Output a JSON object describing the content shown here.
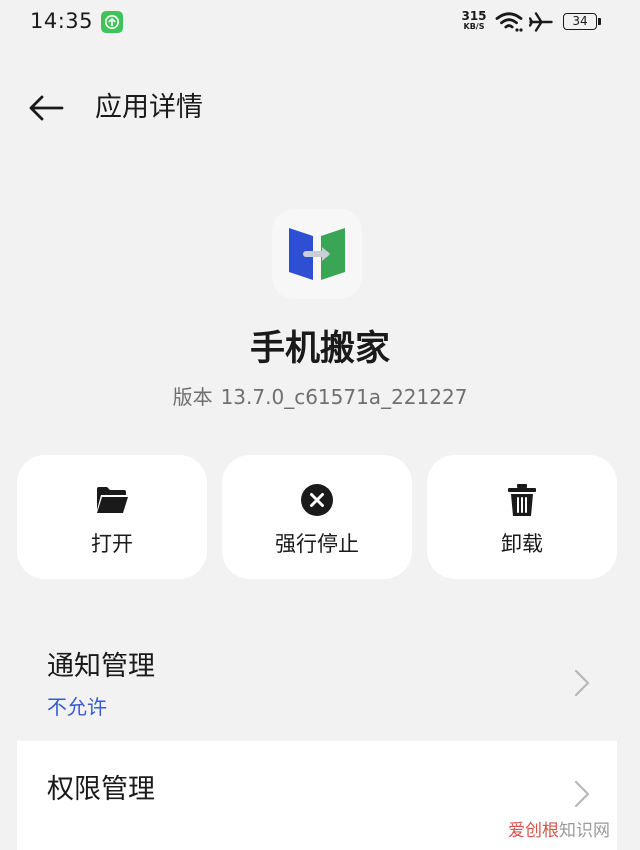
{
  "status_bar": {
    "time": "14:35",
    "net_speed": "315",
    "net_unit": "KB/S",
    "battery": "34",
    "icons": [
      "upload-notification-icon",
      "wifi-icon",
      "airplane-mode-icon",
      "battery-icon"
    ]
  },
  "header": {
    "title": "应用详情",
    "back_icon": "arrow-left-icon"
  },
  "app": {
    "name": "手机搬家",
    "version_label": "版本",
    "version": "13.7.0_c61571a_221227",
    "icon": "phone-clone-app-icon"
  },
  "actions": [
    {
      "label": "打开",
      "icon": "folder-open-icon"
    },
    {
      "label": "强行停止",
      "icon": "close-circle-icon"
    },
    {
      "label": "卸载",
      "icon": "trash-icon"
    }
  ],
  "settings": {
    "notification": {
      "title": "通知管理",
      "status": "不允许"
    },
    "permission": {
      "title": "权限管理"
    }
  },
  "watermark": {
    "part1": "爱创根",
    "part2": "知识网"
  },
  "colors": {
    "background": "#f2f2f2",
    "card": "#ffffff",
    "status_link": "#3c5ad2",
    "upload_badge": "#3fc45a",
    "app_blue": "#2f4fd2",
    "app_green": "#3aa655"
  }
}
